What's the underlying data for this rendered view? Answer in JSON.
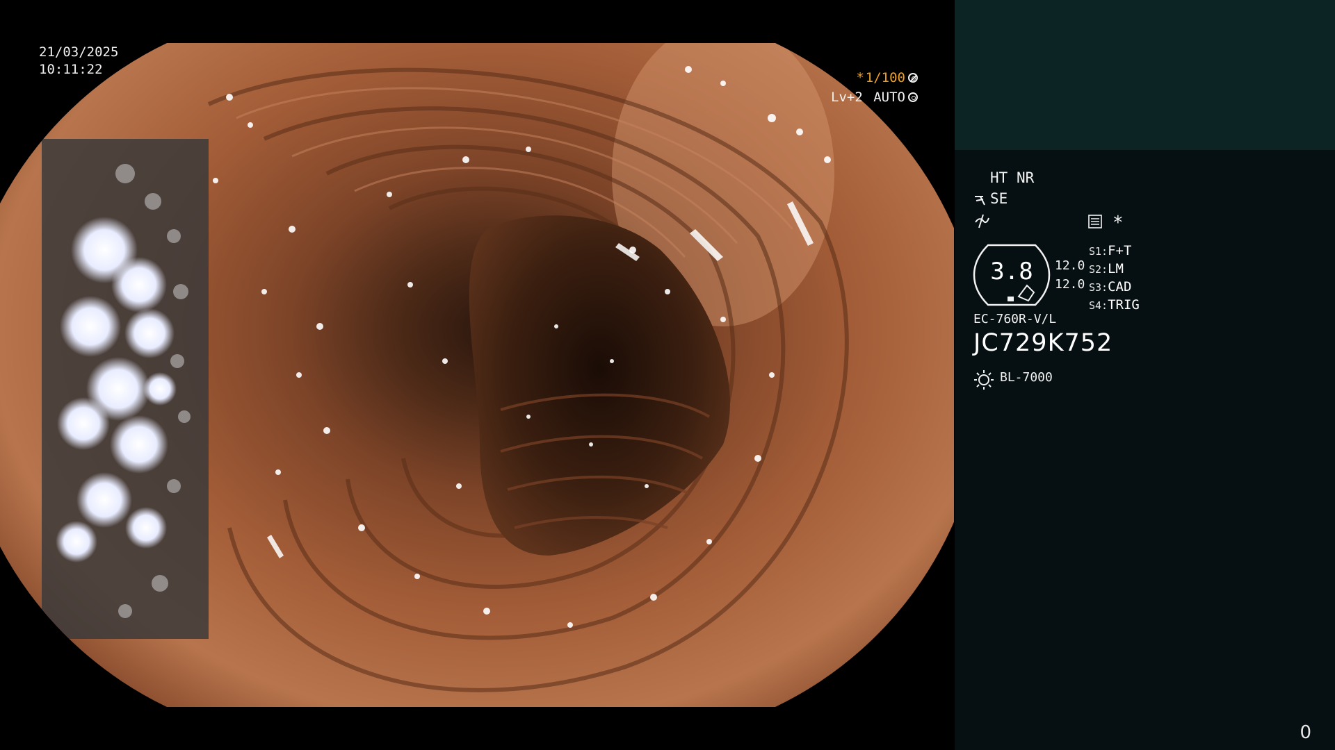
{
  "overlay": {
    "date": "21/03/2025",
    "time": "10:11:22",
    "shutter_prefix": "*",
    "shutter": "1/100",
    "enhance": "Lv+2",
    "iris": "AUTO"
  },
  "panel": {
    "mode_ht": "HT",
    "mode_nr": "NR",
    "se": "SE",
    "asterisk": "*",
    "gauge_value": "3.8",
    "readout_1": "12.0",
    "readout_2": "12.0",
    "switches": [
      {
        "key": "S1:",
        "label": "F+T"
      },
      {
        "key": "S2:",
        "label": "LM"
      },
      {
        "key": "S3:",
        "label": "CAD"
      },
      {
        "key": "S4:",
        "label": "TRIG"
      }
    ],
    "scope_model": "EC-760R-V/L",
    "scope_serial": "JC729K752",
    "light_source": "BL-7000",
    "counter": "0"
  },
  "colors": {
    "accent_amber": "#f0a020",
    "panel_bg": "#061012",
    "panel_top_bg": "#0d2425",
    "mucosa": "#b46a45"
  },
  "icons": [
    "iris-icon",
    "scope-tip-icon",
    "no-signal-icon",
    "keyboard-icon",
    "light-source-icon"
  ]
}
